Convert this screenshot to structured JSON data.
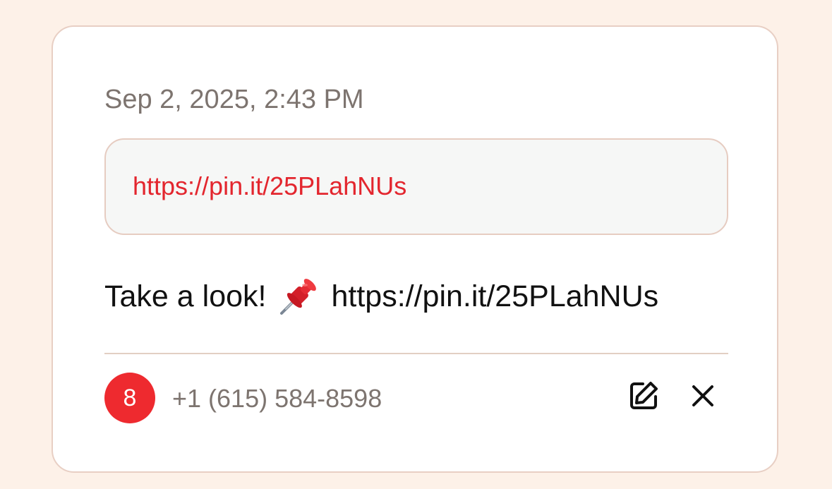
{
  "entry": {
    "timestamp": "Sep 2, 2025, 2:43 PM",
    "link": "https://pin.it/25PLahNUs",
    "message_prefix": "Take a look!",
    "message_emoji": "pushpin",
    "message_link": "https://pin.it/25PLahNUs",
    "avatar_text": "8",
    "phone": "+1 (615) 584-8598"
  },
  "icons": {
    "edit": "edit-icon",
    "close": "close-icon",
    "pin": "pushpin-emoji"
  },
  "colors": {
    "background": "#fdf1e8",
    "link": "#e3262e",
    "avatar": "#ee2a2f",
    "muted_text": "#7d746f",
    "border": "#e8cfc4"
  }
}
